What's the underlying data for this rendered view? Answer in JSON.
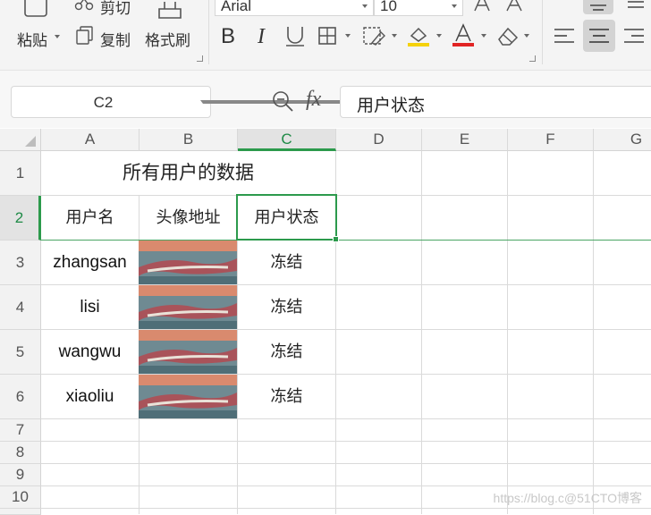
{
  "ribbon": {
    "paste_label": "粘贴",
    "cut_label": "剪切",
    "copy_label": "复制",
    "format_painter_label": "格式刷",
    "font_name": "Arial",
    "font_size": "10",
    "icons": [
      "paste-icon",
      "cut-icon",
      "copy-icon",
      "format-painter-icon",
      "bold-icon",
      "italic-icon",
      "underline-icon",
      "border-icon",
      "fill-pattern-icon",
      "fill-color-icon",
      "font-color-icon",
      "eraser-icon",
      "align-left-icon",
      "align-center-icon",
      "align-right-icon"
    ],
    "accent_colors": {
      "fill": "#f5d20a",
      "font": "#e12424",
      "selection": "#2c9a4c"
    }
  },
  "formula_bar": {
    "name_box": "C2",
    "fx_label": "fx",
    "formula_value": "用户状态"
  },
  "sheet": {
    "columns": [
      "A",
      "B",
      "C",
      "D",
      "E",
      "F",
      "G"
    ],
    "rows": [
      "1",
      "2",
      "3",
      "4",
      "5",
      "6",
      "7",
      "8",
      "9",
      "10"
    ],
    "title": "所有用户的数据",
    "headers": [
      "用户名",
      "头像地址",
      "用户状态"
    ],
    "data": [
      {
        "username": "zhangsan",
        "status": "冻结"
      },
      {
        "username": "lisi",
        "status": "冻结"
      },
      {
        "username": "wangwu",
        "status": "冻结"
      },
      {
        "username": "xiaoliu",
        "status": "冻结"
      }
    ],
    "selected_cell": "C2"
  },
  "watermark": "https://blog.c@51CTO博客"
}
